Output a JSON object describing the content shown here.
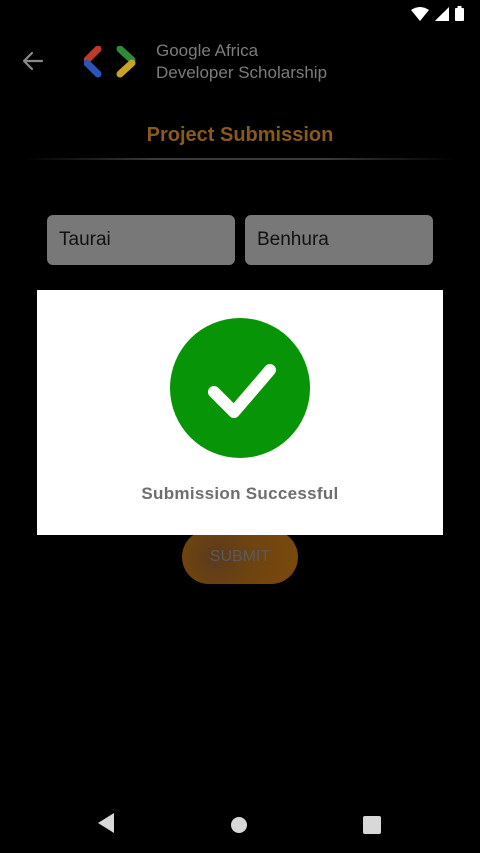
{
  "app": {
    "brand_line1": "Google Africa",
    "brand_line2": "Developer Scholarship"
  },
  "header": {
    "title": "Project Submission",
    "back_icon": "arrow-left-icon"
  },
  "form": {
    "first_name_value": "Taurai",
    "last_name_value": "Benhura",
    "submit_label": "SUBMIT"
  },
  "dialog": {
    "icon": "check-circle-icon",
    "message": "Submission Successful"
  },
  "colors": {
    "accent": "#8a5a1a",
    "success": "#079407",
    "field_bg": "#787878"
  },
  "status_bar": {
    "icons": [
      "wifi-icon",
      "signal-icon",
      "battery-icon"
    ]
  },
  "nav_bar": {
    "icons": [
      "nav-back-icon",
      "nav-home-icon",
      "nav-recents-icon"
    ]
  }
}
